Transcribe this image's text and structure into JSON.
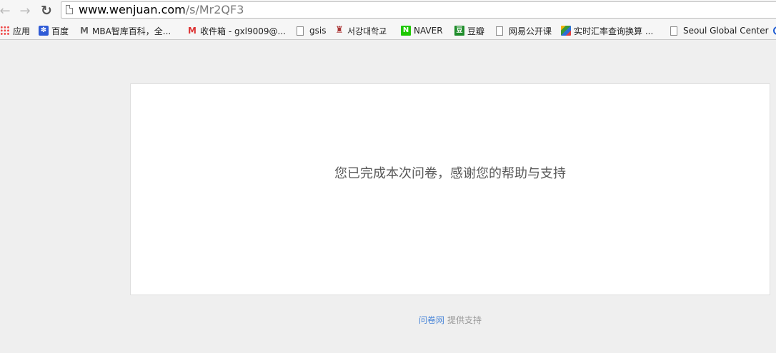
{
  "browser": {
    "nav": {
      "back_glyph": "←",
      "forward_glyph": "→",
      "reload_glyph": "↻"
    },
    "url": {
      "host": "www.wenjuan.com",
      "path": "/s/Mr2QF3"
    },
    "bookmarks": [
      {
        "label": "应用",
        "icon": "apps-grid-icon"
      },
      {
        "label": "百度",
        "icon": "baidu-paw-icon"
      },
      {
        "label": "MBA智库百科，全...",
        "icon": "mba-logo-icon"
      },
      {
        "label": "收件箱 - gxl9009@...",
        "icon": "gmail-icon"
      },
      {
        "label": "gsis",
        "icon": "page-icon"
      },
      {
        "label": "서강대학교",
        "icon": "sogang-shield-icon"
      },
      {
        "label": "NAVER",
        "icon": "naver-n-icon"
      },
      {
        "label": "豆瓣",
        "icon": "douban-icon"
      },
      {
        "label": "网易公开课",
        "icon": "page-icon"
      },
      {
        "label": "实时汇率查询换算 ...",
        "icon": "exchange-rate-icon"
      },
      {
        "label": "Seoul Global Center",
        "icon": "page-icon"
      },
      {
        "label": "",
        "icon": "globe-icon"
      }
    ],
    "bookmark_icon_glyphs": {
      "mba": "M",
      "gmail": "M",
      "sogang": "♜",
      "naver": "N",
      "douban": "豆"
    }
  },
  "page": {
    "message": "您已完成本次问卷，感谢您的帮助与支持",
    "footer": {
      "brand_link": "问卷网",
      "suffix": "提供支持"
    }
  },
  "colors": {
    "background": "#efefef",
    "card": "#ffffff",
    "message_text": "#5a5a5a",
    "brand_link": "#4a86d8",
    "footer_text": "#999999"
  }
}
